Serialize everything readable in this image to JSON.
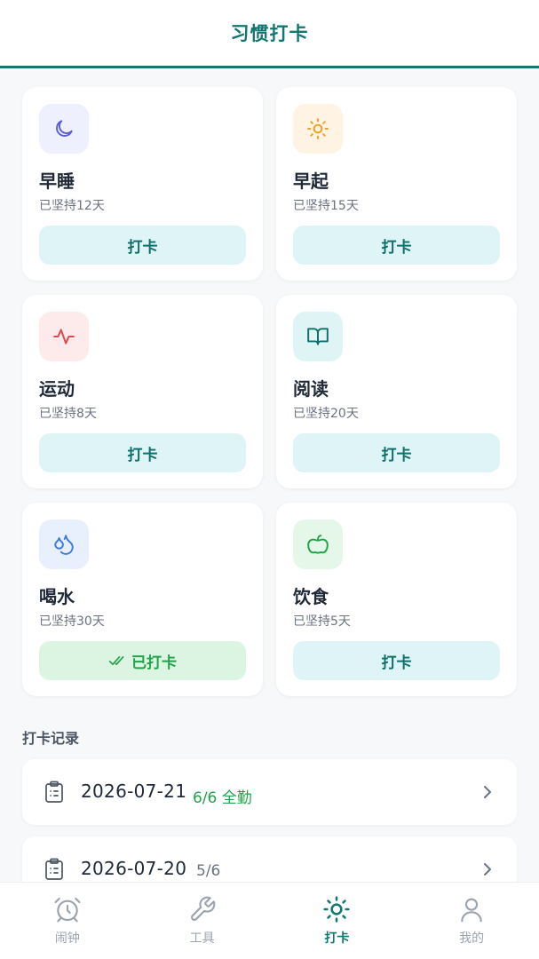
{
  "header": {
    "title": "习惯打卡"
  },
  "habits": [
    {
      "name": "早睡",
      "streak": "已坚持12天",
      "button": "打卡",
      "icon": "moon-icon",
      "icon_bg": "#eef0fd",
      "icon_color": "#5b5fd6",
      "done": false
    },
    {
      "name": "早起",
      "streak": "已坚持15天",
      "button": "打卡",
      "icon": "sun-icon",
      "icon_bg": "#fff3e4",
      "icon_color": "#f0a01e",
      "done": false
    },
    {
      "name": "运动",
      "streak": "已坚持8天",
      "button": "打卡",
      "icon": "activity-icon",
      "icon_bg": "#fdeaea",
      "icon_color": "#e0464a",
      "done": false
    },
    {
      "name": "阅读",
      "streak": "已坚持20天",
      "button": "打卡",
      "icon": "book-icon",
      "icon_bg": "#dff4f4",
      "icon_color": "#0f6f6a",
      "done": false
    },
    {
      "name": "喝水",
      "streak": "已坚持30天",
      "button": "已打卡",
      "icon": "droplets-icon",
      "icon_bg": "#e8f0fd",
      "icon_color": "#3b7be0",
      "done": true
    },
    {
      "name": "饮食",
      "streak": "已坚持5天",
      "button": "打卡",
      "icon": "apple-icon",
      "icon_bg": "#e4f7e9",
      "icon_color": "#22a24a",
      "done": false
    }
  ],
  "records": {
    "title": "打卡记录",
    "items": [
      {
        "date": "2026-07-21",
        "status": "6/6 全勤",
        "status_color": "#22a24a"
      },
      {
        "date": "2026-07-20",
        "status": "5/6",
        "status_color": "#6b7280"
      }
    ]
  },
  "tabs": [
    {
      "label": "闹钟",
      "icon": "alarm-clock-icon",
      "active": false
    },
    {
      "label": "工具",
      "icon": "wrench-icon",
      "active": false
    },
    {
      "label": "打卡",
      "icon": "sun-icon",
      "active": true
    },
    {
      "label": "我的",
      "icon": "user-icon",
      "active": false
    }
  ],
  "colors": {
    "accent": "#11776f",
    "inactive": "#9ca3af",
    "done": "#22a24a"
  }
}
